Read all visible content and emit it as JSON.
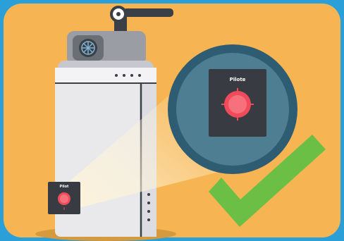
{
  "illustration": {
    "knob_label_large": "Pilote",
    "knob_label_small": "Pilot"
  },
  "colors": {
    "frame": "#2a9fd8",
    "panel": "#f6b552",
    "heater_body": "#e9e9ec",
    "heater_shadow": "#cfcfd6",
    "top_unit": "#9a9da4",
    "dark": "#3b3f46",
    "magnifier_ring": "#2e5d73",
    "magnifier_fill": "#4d7e91",
    "knob_panel": "#383c42",
    "knob_red": "#f04b5a",
    "check_green": "#6cbf45"
  },
  "icons": {
    "checkmark": "checkmark-icon",
    "fan": "fan-icon"
  }
}
